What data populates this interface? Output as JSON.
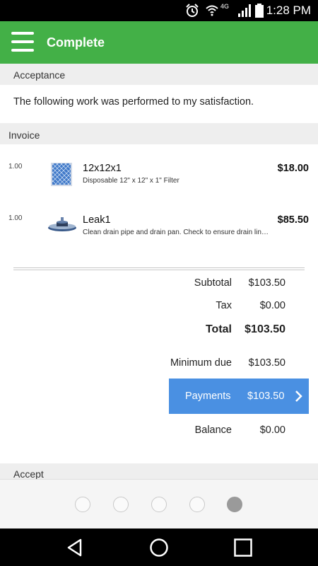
{
  "status_bar": {
    "time": "1:28 PM",
    "network_label": "4G",
    "icons": [
      "alarm-icon",
      "wifi-icon",
      "signal-icon",
      "battery-icon"
    ]
  },
  "app_bar": {
    "title": "Complete",
    "menu_icon": "hamburger-menu-icon",
    "color": "#43b047"
  },
  "acceptance": {
    "header": "Acceptance",
    "statement": "The following work was performed to my satisfaction."
  },
  "invoice": {
    "header": "Invoice",
    "items": [
      {
        "qty": "1.00",
        "name": "12x12x1",
        "description": "Disposable 12\" x 12\" x 1\" Filter",
        "price": "$18.00",
        "thumbnail": "air-filter-icon"
      },
      {
        "qty": "1.00",
        "name": "Leak1",
        "description": "Clean drain pipe and drain pan. Check to ensure drain line is clear",
        "price": "$85.50",
        "thumbnail": "drain-pan-icon"
      }
    ]
  },
  "totals": {
    "subtotal_label": "Subtotal",
    "subtotal_value": "$103.50",
    "tax_label": "Tax",
    "tax_value": "$0.00",
    "total_label": "Total",
    "total_value": "$103.50",
    "minimum_due_label": "Minimum due",
    "minimum_due_value": "$103.50",
    "payments_label": "Payments",
    "payments_value": "$103.50",
    "payments_color": "#4a90e2",
    "balance_label": "Balance",
    "balance_value": "$0.00"
  },
  "accept_section": {
    "header": "Accept"
  },
  "pager": {
    "page_count": 5,
    "active_page": 5
  },
  "nav_bar": {
    "icons": [
      "back-icon",
      "home-icon",
      "recents-icon"
    ]
  }
}
